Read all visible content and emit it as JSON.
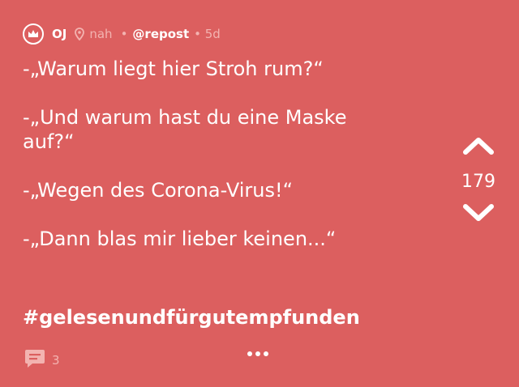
{
  "header": {
    "author": "OJ",
    "location": "nah",
    "separator": "•",
    "channel": "@repost",
    "age": "• 5d"
  },
  "post": {
    "lines": [
      "-„Warum liegt hier Stroh rum?“",
      "-„Und warum hast du eine Maske",
      "auf?“",
      "-„Wegen des Corona-Virus!“",
      "-„Dann blas mir lieber keinen...“"
    ],
    "hashtag": "#gelesenundfürgutempfunden"
  },
  "vote": {
    "count": "179"
  },
  "footer": {
    "comment_count": "3"
  },
  "colors": {
    "background": "#dc5f5f",
    "muted": "#f3b3b0",
    "text": "#ffffff"
  }
}
